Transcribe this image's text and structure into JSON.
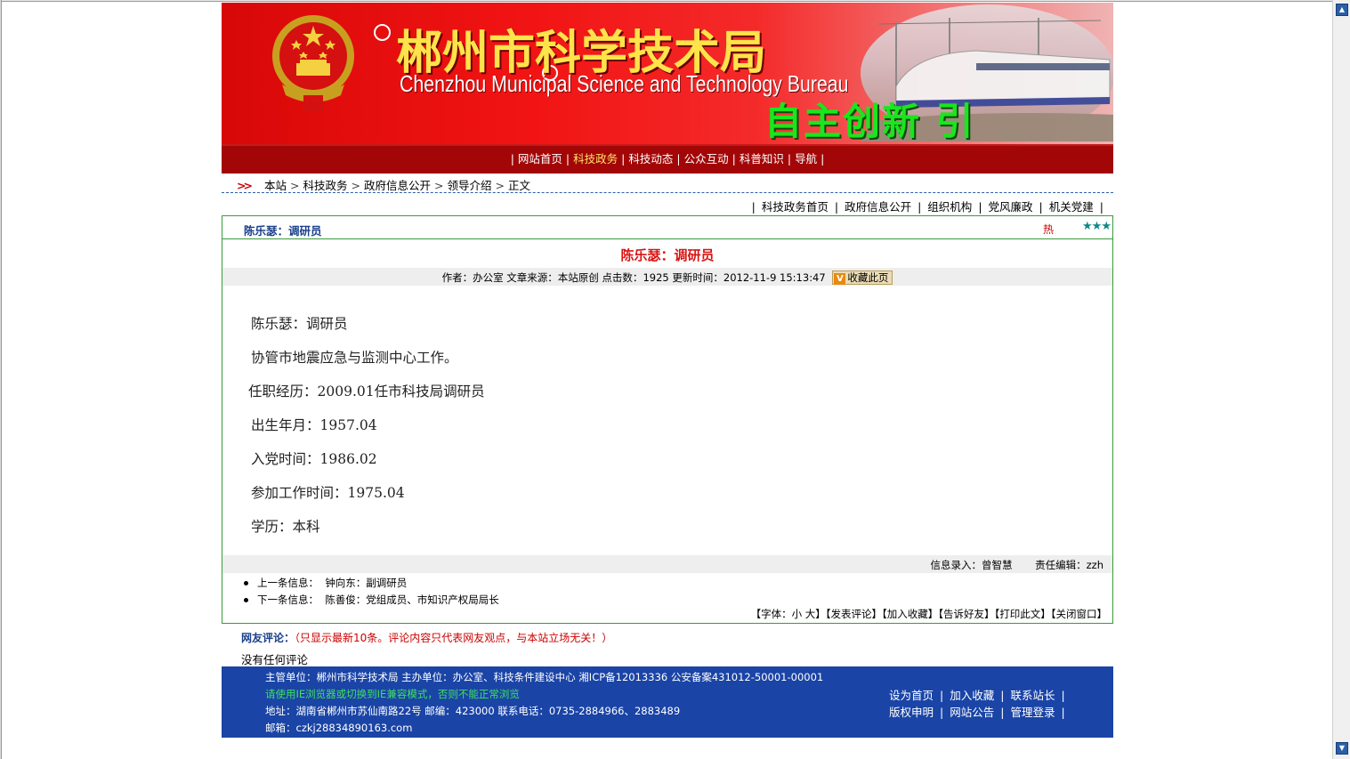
{
  "banner": {
    "title": "郴州市科学技术局",
    "subtitle": "Chenzhou Municipal  Science and Technology Bureau",
    "slogan": "自主创新 引"
  },
  "nav": {
    "items": [
      {
        "label": "网站首页",
        "active": false
      },
      {
        "label": "科技政务",
        "active": true
      },
      {
        "label": "科技动态",
        "active": false
      },
      {
        "label": "公众互动",
        "active": false
      },
      {
        "label": "科普知识",
        "active": false
      },
      {
        "label": "导航",
        "active": false
      }
    ]
  },
  "breadcrumb": {
    "items": [
      "本站",
      "科技政务",
      "政府信息公开",
      "领导介绍",
      "正文"
    ]
  },
  "subnav": {
    "items": [
      "科技政务首页",
      "政府信息公开",
      "组织机构",
      "党风廉政",
      "机关党建"
    ]
  },
  "article": {
    "header_title": "陈乐瑟：调研员",
    "hot_label": "热",
    "stars": "★★★",
    "title": "陈乐瑟：调研员",
    "meta": {
      "author_label": "作者：",
      "author": "办公室",
      "source_label": "文章来源：",
      "source": "本站原创",
      "clicks_label": "点击数：",
      "clicks": "1925",
      "updated_label": "更新时间：",
      "updated": "2012-11-9 15:13:47",
      "favorite_label": "收藏此页"
    },
    "body": [
      "陈乐瑟：调研员",
      "协管市地震应急与监测中心工作。",
      "任职经历：2009.01任市科技局调研员",
      "出生年月：1957.04",
      "入党时间：1986.02",
      "参加工作时间：1975.04",
      "学历：本科"
    ],
    "entry_label": "信息录入：",
    "entry_by": "曾智慧",
    "editor_label": "责任编辑：",
    "editor": "zzh",
    "prev_label": "上一条信息：",
    "prev": "钟向东：副调研员",
    "next_label": "下一条信息：",
    "next": "陈善俊：党组成员、市知识产权局局长",
    "tools": {
      "font_label": "【字体：",
      "font_small": "小",
      "font_large": "大",
      "font_close": "】",
      "comment": "【发表评论】",
      "favorite": "【加入收藏】",
      "tell": "【告诉好友】",
      "print": "【打印此文】",
      "close": "【关闭窗口】"
    }
  },
  "comments": {
    "label": "网友评论：",
    "note": "（只显示最新10条。评论内容只代表网友观点，与本站立场无关！）",
    "empty": "没有任何评论"
  },
  "footer": {
    "line1": "主管单位：郴州市科学技术局 主办单位：办公室、科技条件建设中心 湘ICP备12013336 公安备案431012-50001-00001",
    "warning": "请使用IE浏览器或切换到IE兼容模式，否则不能正常浏览",
    "line3": "地址：湖南省郴州市苏仙南路22号 邮编：423000 联系电话：0735-2884966、2883489",
    "line4": "邮箱：czkj28834890163.com",
    "links_row1": [
      "设为首页",
      "加入收藏",
      "联系站长"
    ],
    "links_row2": [
      "版权申明",
      "网站公告",
      "管理登录"
    ]
  },
  "colors": {
    "banner_red": "#e01010",
    "nav_red": "#a30606",
    "active_nav": "#ffe16b",
    "article_border": "#3a9a3a",
    "title_red": "#d81414",
    "footer_blue": "#1a44a6"
  }
}
